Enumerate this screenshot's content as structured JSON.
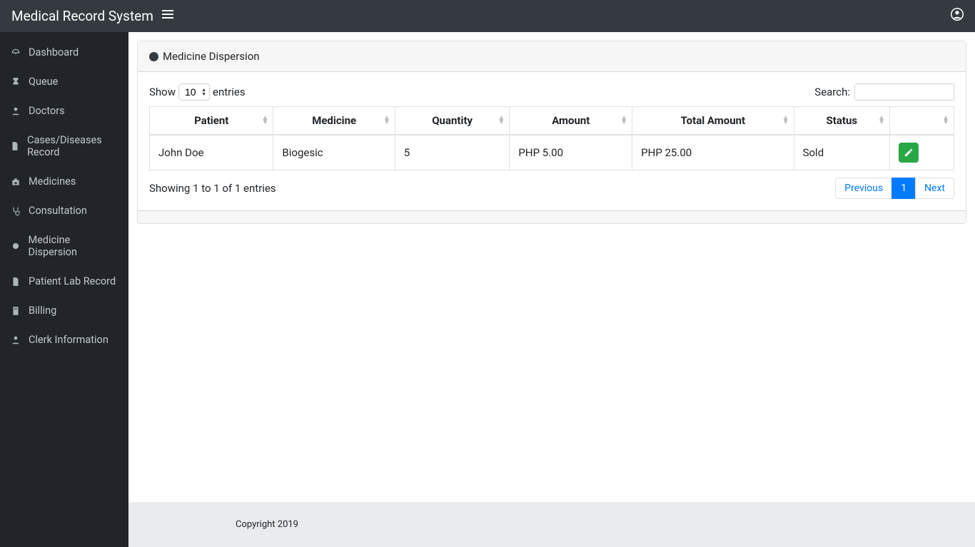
{
  "navbar": {
    "brand": "Medical Record System"
  },
  "sidebar": {
    "items": [
      {
        "label": "Dashboard",
        "icon": "dashboard-icon"
      },
      {
        "label": "Queue",
        "icon": "hourglass-icon"
      },
      {
        "label": "Doctors",
        "icon": "user-md-icon"
      },
      {
        "label": "Cases/Diseases Record",
        "icon": "file-icon"
      },
      {
        "label": "Medicines",
        "icon": "briefcase-medical-icon"
      },
      {
        "label": "Consultation",
        "icon": "stethoscope-icon"
      },
      {
        "label": "Medicine Dispersion",
        "icon": "circle-icon"
      },
      {
        "label": "Patient Lab Record",
        "icon": "file-icon"
      },
      {
        "label": "Billing",
        "icon": "file-invoice-icon"
      },
      {
        "label": "Clerk Information",
        "icon": "user-icon"
      }
    ]
  },
  "page": {
    "title": "Medicine Dispersion"
  },
  "datatable": {
    "length": {
      "show_label": "Show",
      "entries_label": "entries",
      "value": "10"
    },
    "search": {
      "label": "Search:",
      "value": ""
    },
    "columns": [
      "Patient",
      "Medicine",
      "Quantity",
      "Amount",
      "Total Amount",
      "Status",
      ""
    ],
    "rows": [
      {
        "patient": "John Doe",
        "medicine": "Biogesic",
        "quantity": "5",
        "amount": "PHP 5.00",
        "total_amount": "PHP 25.00",
        "status": "Sold"
      }
    ],
    "info": "Showing 1 to 1 of 1 entries",
    "pagination": {
      "previous": "Previous",
      "next": "Next",
      "current": "1"
    }
  },
  "footer": {
    "copyright": "Copyright 2019"
  }
}
